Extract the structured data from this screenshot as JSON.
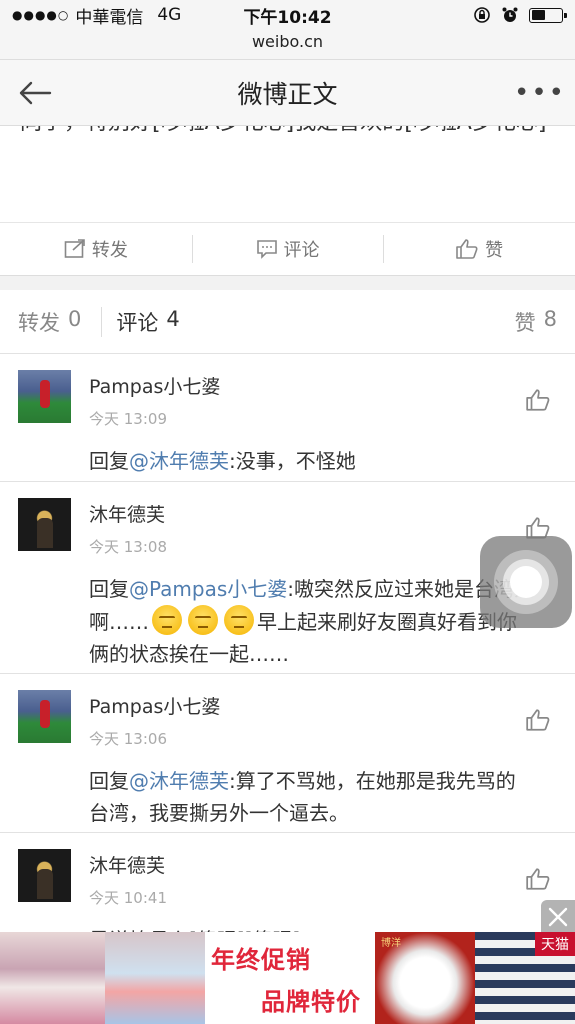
{
  "status_bar": {
    "carrier": "中華電信",
    "network": "4G",
    "time": "下午10:42"
  },
  "url": "weibo.cn",
  "nav": {
    "title": "微博正文",
    "more": "•••"
  },
  "post": {
    "text": "同学，特别好[哆啦A梦花心]我是喜欢的[哆啦A梦花心]"
  },
  "post_actions": {
    "repost_label": "转发",
    "comment_label": "评论",
    "like_label": "赞"
  },
  "tabs": {
    "repost_label": "转发",
    "repost_count": "0",
    "comment_label": "评论",
    "comment_count": "4",
    "like_label": "赞",
    "like_count": "8"
  },
  "comments": [
    {
      "user": "Pampas小七婆",
      "time": "今天 13:09",
      "prefix": "回复",
      "mention": "@沐年德芙",
      "text": ":没事，不怪她"
    },
    {
      "user": "沐年德芙",
      "time": "今天 13:08",
      "prefix": "回复",
      "mention": "@Pampas小七婆",
      "text": ":嗷突然反应过来她是台湾人啊……",
      "text2": "早上起来刷好友圈真好看到你俩的状态挨在一起……"
    },
    {
      "user": "Pampas小七婆",
      "time": "今天 13:06",
      "prefix": "回复",
      "mention": "@沐年德芙",
      "text": ":算了不骂她，在她那是我先骂的台湾，我要撕另外一个逼去。"
    },
    {
      "user": "沐年德芙",
      "time": "今天 10:41",
      "text": "是说煌月么[傻眼][傻眼]"
    }
  ],
  "ad": {
    "headline": "年终促销",
    "subline": "品牌特价",
    "brand": "博洋",
    "store": "天猫"
  },
  "colors": {
    "mention": "#507daf",
    "ad_red": "#e0263a"
  }
}
